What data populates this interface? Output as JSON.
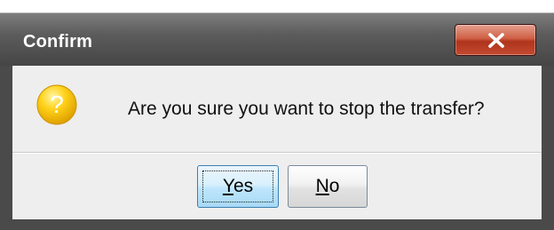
{
  "dialog": {
    "title": "Confirm",
    "close_icon": "close-icon",
    "message_icon": "question-icon",
    "message": "Are you sure you want to stop the transfer?",
    "buttons": {
      "yes": {
        "mnemonic": "Y",
        "rest": "es"
      },
      "no": {
        "mnemonic": "N",
        "rest": "o"
      }
    },
    "colors": {
      "titlebar": "#5c5c5c",
      "close_button": "#c24a30",
      "focused_button": "#bee6fd",
      "icon": "#f2c400"
    }
  }
}
